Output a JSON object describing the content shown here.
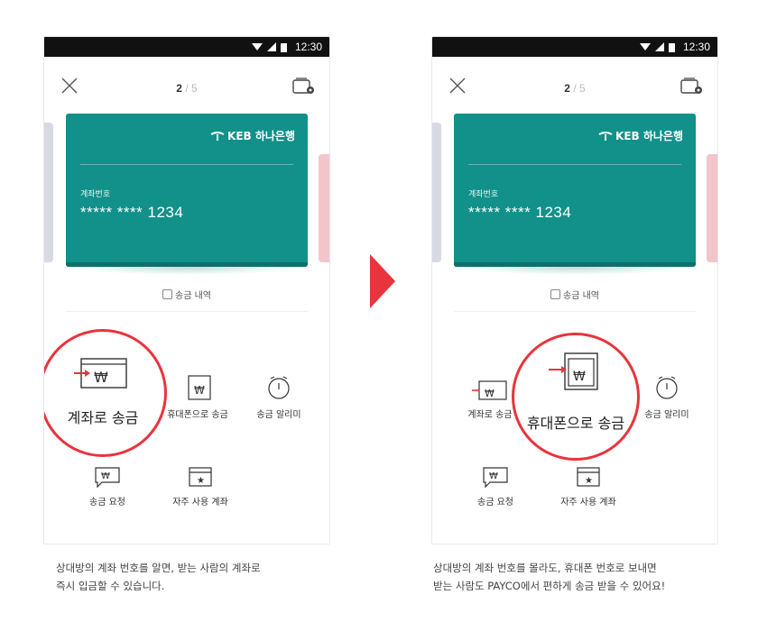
{
  "left": {
    "status_time": "12:30",
    "pager": {
      "current": "2",
      "separator": "/",
      "total": "5"
    },
    "bank_name": "KEB 하나은행",
    "account_label": "계좌번호",
    "account_number": "***** **** 1234",
    "history": "송금 내역",
    "menu": {
      "phone_transfer": "휴대폰으로 송금",
      "transfer_alarm": "송금 알리미",
      "transfer_request": "송금 요청",
      "frequent_accounts": "자주 사용 계좌"
    },
    "highlight_label": "계좌로 송금",
    "caption_line1": "상대방의 계좌 번호를 알면, 받는 사람의 계좌로",
    "caption_line2": "즉시 입금할 수 있습니다."
  },
  "right": {
    "status_time": "12:30",
    "pager": {
      "current": "2",
      "separator": "/",
      "total": "5"
    },
    "bank_name": "KEB 하나은행",
    "account_label": "계좌번호",
    "account_number": "***** **** 1234",
    "history": "송금 내역",
    "menu": {
      "account_transfer": "계좌로 송금",
      "transfer_alarm": "송금 알리미",
      "transfer_request": "송금 요청",
      "frequent_accounts": "자주 사용 계좌"
    },
    "highlight_label": "휴대폰으로 송금",
    "caption_line1": "상대방의 계좌 번호를 몰라도, 휴대폰 번호로 보내면",
    "caption_line2": "받는 사람도 PAYCO에서 편하게 송금 받을 수 있어요!"
  },
  "colors": {
    "card": "#12908a",
    "accent": "#e8343c"
  }
}
